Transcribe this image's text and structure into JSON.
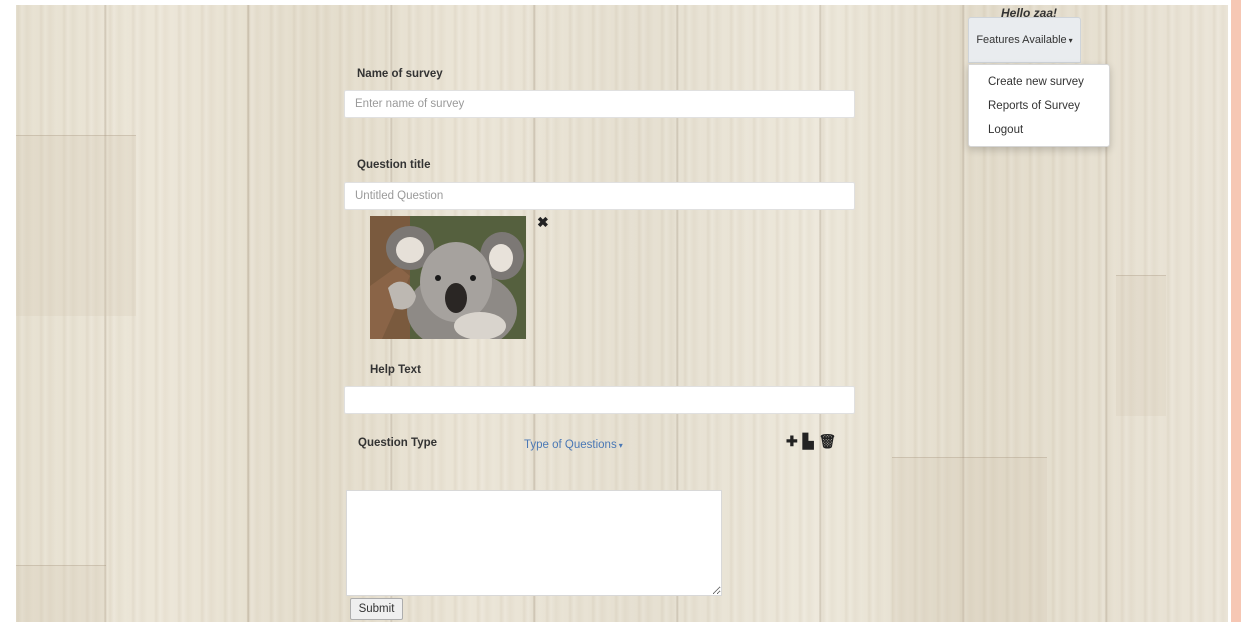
{
  "header": {
    "greeting": "Hello zaa!",
    "features_button": "Features Available"
  },
  "features_menu": {
    "items": [
      "Create new survey",
      "Reports of Survey",
      "Logout"
    ]
  },
  "survey_form": {
    "name_label": "Name of survey",
    "name_placeholder": "Enter name of survey",
    "question_title_label": "Question title",
    "question_title_placeholder": "Untitled Question",
    "image_alt": "koala",
    "help_text_label": "Help Text",
    "help_text_value": "",
    "question_type_label": "Question Type",
    "question_type_dropdown": "Type of Questions",
    "answer_value": "",
    "submit_label": "Submit"
  },
  "icons": {
    "remove_image": "close-icon",
    "add_question": "plus-icon",
    "copy_question": "copy-icon",
    "delete_question": "trash-icon"
  },
  "colors": {
    "link": "#4a78b5",
    "frame_accent": "#f6c7b4",
    "menu_button_bg": "#e9ecef"
  }
}
